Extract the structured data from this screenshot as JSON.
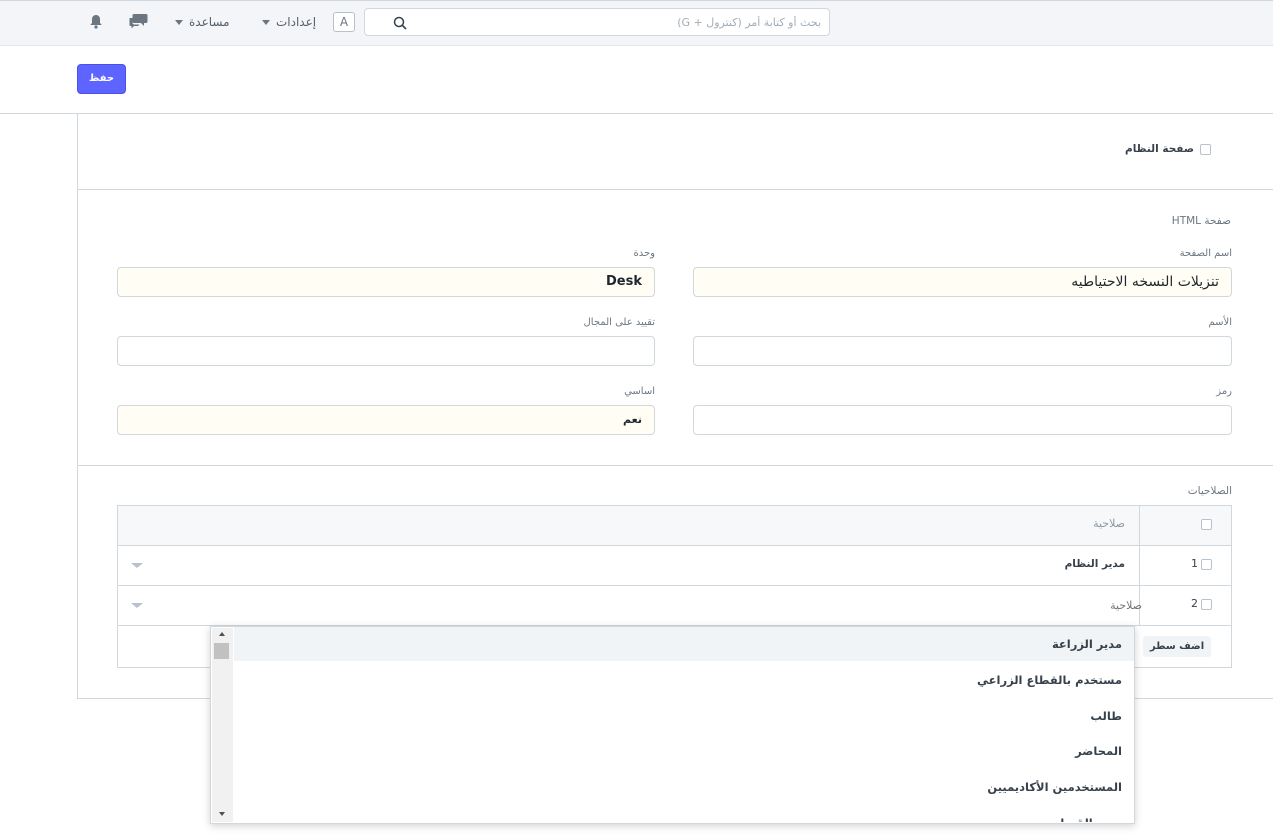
{
  "navbar": {
    "search_placeholder": "بحث أو كتابة أمر (كنترول + G)",
    "avatar_letter": "A",
    "settings_label": "إعدادات",
    "help_label": "مساعدة"
  },
  "toolbar": {
    "save_label": "حفظ"
  },
  "system_page": {
    "label": "صفحة النظام",
    "checked": false
  },
  "html_section": {
    "title": "صفحة HTML",
    "fields": {
      "page_name": {
        "label": "اسم الصفحة",
        "value": "تنزيلات النسخه الاحتياطيه"
      },
      "module": {
        "label": "وحدة",
        "value": "Desk"
      },
      "name": {
        "label": "الأسم",
        "value": ""
      },
      "restrict_to_domain": {
        "label": "تقييد على المجال",
        "value": ""
      },
      "icon": {
        "label": "رمز",
        "value": ""
      },
      "standard": {
        "label": "اساسي",
        "value": "نعم"
      }
    }
  },
  "roles_section": {
    "title": "الصلاحيات",
    "column_role": "صلاحية",
    "rows": [
      {
        "index": "1",
        "role": "مدير النظام"
      },
      {
        "index": "2",
        "role": "",
        "placeholder": "صلاحية"
      }
    ],
    "add_row_label": "اضف سطر"
  },
  "dropdown": {
    "options": [
      "مدير الزراعة",
      "مستخدم بالقطاع الزراعي",
      "طالب",
      "المحاضر",
      "المستخدمين الأكاديميين",
      "مدير القبول"
    ],
    "highlighted_index": 0
  }
}
